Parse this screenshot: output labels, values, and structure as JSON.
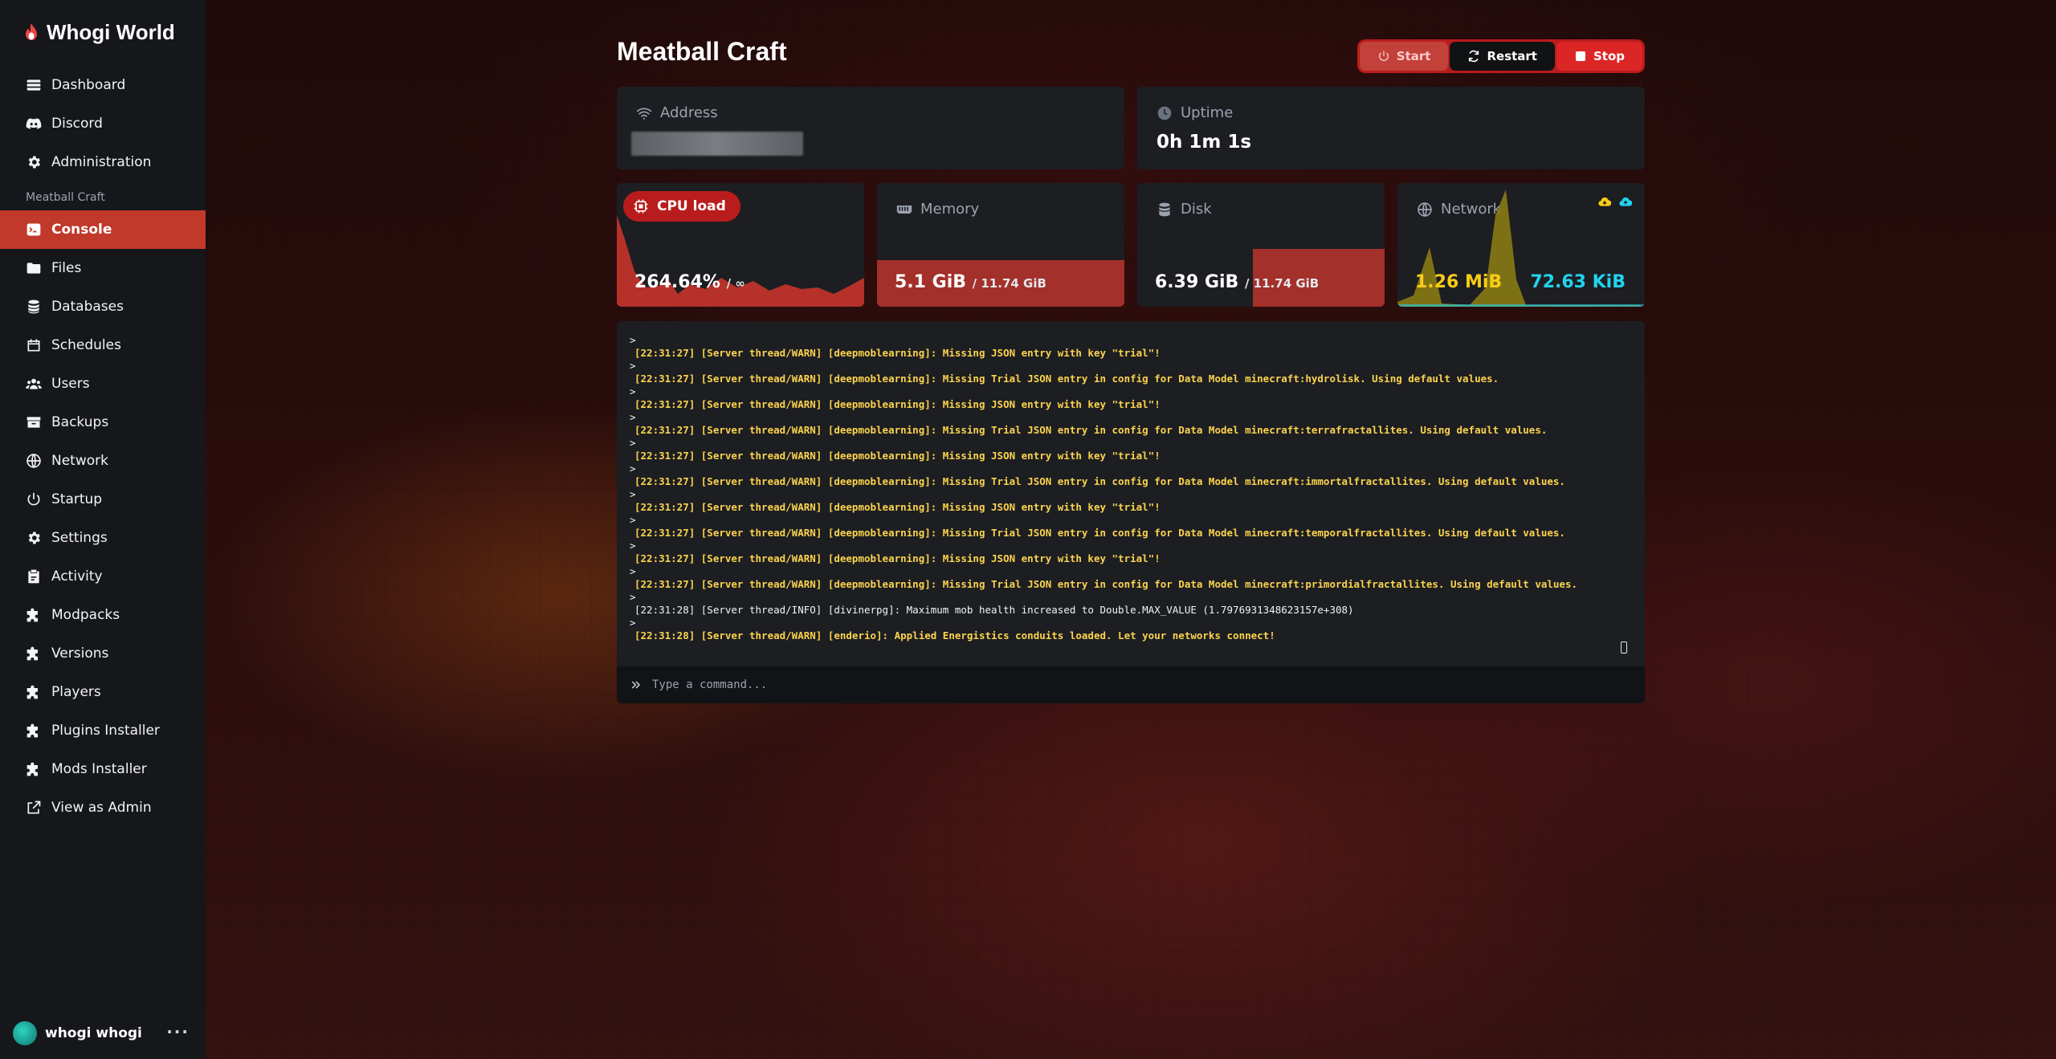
{
  "app": {
    "brand": "Whogi World"
  },
  "sidebar": {
    "top_items": [
      {
        "label": "Dashboard",
        "icon": "dashboard-icon"
      },
      {
        "label": "Discord",
        "icon": "discord-icon"
      },
      {
        "label": "Administration",
        "icon": "gear-icon"
      }
    ],
    "section_title": "Meatball Craft",
    "server_items": [
      {
        "label": "Console",
        "icon": "terminal-icon",
        "active": true
      },
      {
        "label": "Files",
        "icon": "folder-icon"
      },
      {
        "label": "Databases",
        "icon": "database-icon"
      },
      {
        "label": "Schedules",
        "icon": "calendar-icon"
      },
      {
        "label": "Users",
        "icon": "users-icon"
      },
      {
        "label": "Backups",
        "icon": "archive-icon"
      },
      {
        "label": "Network",
        "icon": "globe-icon"
      },
      {
        "label": "Startup",
        "icon": "power-icon"
      },
      {
        "label": "Settings",
        "icon": "gear-icon"
      },
      {
        "label": "Activity",
        "icon": "clipboard-icon"
      },
      {
        "label": "Modpacks",
        "icon": "puzzle-icon"
      },
      {
        "label": "Versions",
        "icon": "puzzle-icon"
      },
      {
        "label": "Players",
        "icon": "puzzle-icon"
      },
      {
        "label": "Plugins Installer",
        "icon": "puzzle-icon"
      },
      {
        "label": "Mods Installer",
        "icon": "puzzle-icon"
      },
      {
        "label": "View as Admin",
        "icon": "external-link-icon"
      }
    ],
    "user": {
      "name": "whogi whogi",
      "more": "···"
    }
  },
  "server": {
    "title": "Meatball Craft",
    "power": {
      "start": "Start",
      "restart": "Restart",
      "stop": "Stop"
    }
  },
  "stats": {
    "address": {
      "label": "Address"
    },
    "uptime": {
      "label": "Uptime",
      "value": "0h 1m 1s"
    },
    "cpu": {
      "label": "CPU load",
      "value": "264.64%",
      "limit": "/ ∞"
    },
    "memory": {
      "label": "Memory",
      "value": "5.1 GiB",
      "limit": "/ 11.74 GiB"
    },
    "disk": {
      "label": "Disk",
      "value": "6.39 GiB",
      "limit": "/ 11.74 GiB"
    },
    "network": {
      "label": "Network",
      "inbound": "1.26 MiB",
      "outbound": "72.63 KiB"
    }
  },
  "colors": {
    "accent": "#c0392b",
    "warn": "#fcd34d",
    "inbound": "#facc15",
    "outbound": "#22d3ee"
  },
  "console": {
    "lines": [
      {
        "level": "warn",
        "text": "[22:31:27] [Server thread/WARN] [deepmoblearning]: Missing JSON entry with key \"trial\"!"
      },
      {
        "level": "warn",
        "text": "[22:31:27] [Server thread/WARN] [deepmoblearning]: Missing Trial JSON entry in config for Data Model minecraft:hydrolisk. Using default values."
      },
      {
        "level": "warn",
        "text": "[22:31:27] [Server thread/WARN] [deepmoblearning]: Missing JSON entry with key \"trial\"!"
      },
      {
        "level": "warn",
        "text": "[22:31:27] [Server thread/WARN] [deepmoblearning]: Missing Trial JSON entry in config for Data Model minecraft:terrafractallites. Using default values."
      },
      {
        "level": "warn",
        "text": "[22:31:27] [Server thread/WARN] [deepmoblearning]: Missing JSON entry with key \"trial\"!"
      },
      {
        "level": "warn",
        "text": "[22:31:27] [Server thread/WARN] [deepmoblearning]: Missing Trial JSON entry in config for Data Model minecraft:immortalfractallites. Using default values."
      },
      {
        "level": "warn",
        "text": "[22:31:27] [Server thread/WARN] [deepmoblearning]: Missing JSON entry with key \"trial\"!"
      },
      {
        "level": "warn",
        "text": "[22:31:27] [Server thread/WARN] [deepmoblearning]: Missing Trial JSON entry in config for Data Model minecraft:temporalfractallites. Using default values."
      },
      {
        "level": "warn",
        "text": "[22:31:27] [Server thread/WARN] [deepmoblearning]: Missing JSON entry with key \"trial\"!"
      },
      {
        "level": "warn",
        "text": "[22:31:27] [Server thread/WARN] [deepmoblearning]: Missing Trial JSON entry in config for Data Model minecraft:primordialfractallites. Using default values."
      },
      {
        "level": "info",
        "text": "[22:31:28] [Server thread/INFO] [divinerpg]: Maximum mob health increased to Double.MAX_VALUE (1.7976931348623157e+308)"
      },
      {
        "level": "warn",
        "text": "[22:31:28] [Server thread/WARN] [enderio]: Applied Energistics conduits loaded. Let your networks connect!"
      }
    ],
    "prompt": ">",
    "placeholder": "Type a command..."
  }
}
